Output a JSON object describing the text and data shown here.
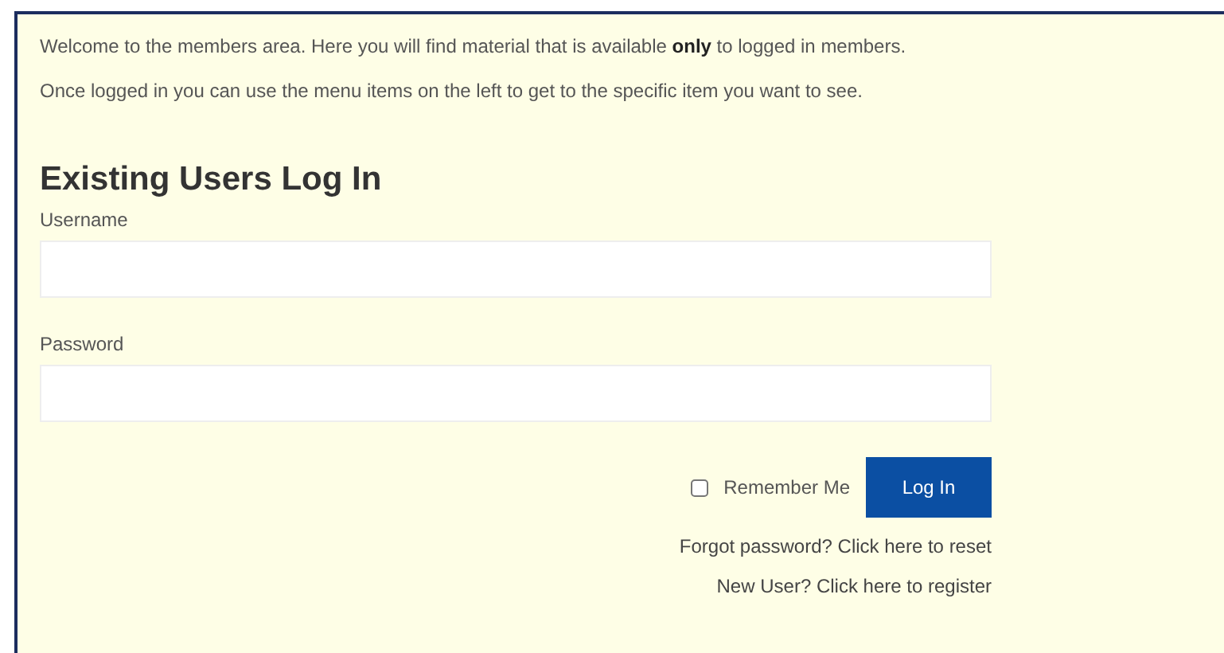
{
  "intro": [
    "Welcome to the members area. Here you will find material that is available **only** to logged in members.",
    "Once logged in you can use the menu items on the left to get to the specific item you want to see."
  ],
  "login": {
    "heading": "Existing Users Log In",
    "fields": [
      {
        "label": "Username"
      },
      {
        "label": "Password"
      }
    ],
    "remember": {
      "label": "Remember Me",
      "checked": false
    },
    "button": "Log In",
    "links": [
      "Forgot password? Click here to reset",
      "New User? Click here to register"
    ]
  }
}
